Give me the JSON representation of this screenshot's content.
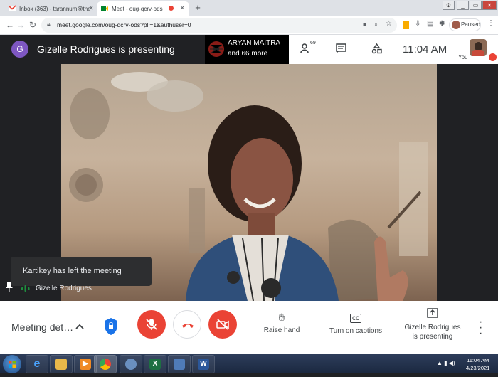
{
  "browser": {
    "tabs": [
      {
        "title": "Inbox (363) - tarannum@theindi",
        "active": false
      },
      {
        "title": "Meet - oug-qcrv-ods",
        "active": true
      }
    ],
    "new_tab_glyph": "+",
    "url": "meet.google.com/oug-qcrv-ods?pli=1&authuser=0",
    "profile_status": "Paused",
    "window_controls": [
      "minimize",
      "restore",
      "close"
    ]
  },
  "meet_header": {
    "avatar_letter": "G",
    "presenting_title": "Gizelle Rodrigues is presenting",
    "active_speaker_name": "ARYAN MAITRA",
    "active_speaker_more": "and 66 more",
    "people_count": "69",
    "clock": "11:04 AM",
    "you_label": "You"
  },
  "stage": {
    "toast": "Kartikey has left the meeting",
    "tile_name": "Gizelle Rodrigues"
  },
  "bottom_bar": {
    "meeting_details": "Meeting det…",
    "raise_hand": "Raise hand",
    "captions": "Turn on captions",
    "presenting_line1": "Gizelle Rodrigues",
    "presenting_line2": "is presenting"
  },
  "taskbar": {
    "time": "11:04 AM",
    "date": "4/23/2021",
    "apps": [
      "internet-explorer",
      "file-explorer",
      "media-player",
      "chrome",
      "chrome-2",
      "excel",
      "remote-desktop",
      "word"
    ]
  },
  "colors": {
    "meet_dark": "#202124",
    "danger_red": "#ea4335",
    "avatar_purple": "#7e57c2"
  }
}
